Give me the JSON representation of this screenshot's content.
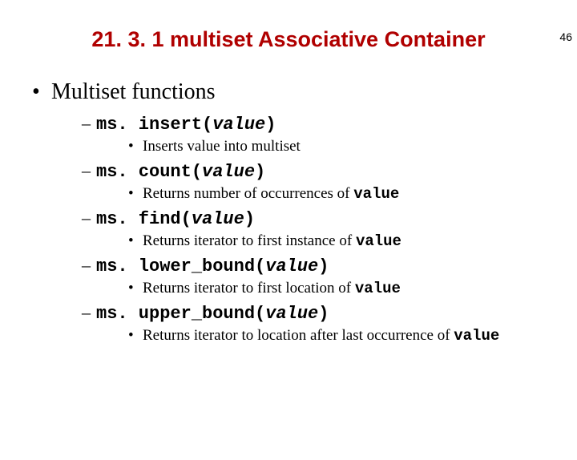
{
  "page_number": "46",
  "title": "21. 3. 1 multiset Associative Container",
  "bullet_l1": "•",
  "dash": "–",
  "bullet_l3": "•",
  "h1": "Multiset functions",
  "items": [
    {
      "code_pre": "ms. insert(",
      "code_arg": "value",
      "code_post": ")",
      "desc_pre": "Inserts value into multiset",
      "desc_code": ""
    },
    {
      "code_pre": "ms. count(",
      "code_arg": "value",
      "code_post": ")",
      "desc_pre": "Returns number of occurrences of ",
      "desc_code": "value"
    },
    {
      "code_pre": "ms. find(",
      "code_arg": "value",
      "code_post": ")",
      "desc_pre": "Returns iterator to first instance of ",
      "desc_code": "value"
    },
    {
      "code_pre": "ms. lower_bound(",
      "code_arg": "value",
      "code_post": ")",
      "desc_pre": "Returns iterator to first location of  ",
      "desc_code": "value"
    },
    {
      "code_pre": "ms. upper_bound(",
      "code_arg": "value",
      "code_post": ")",
      "desc_pre": "Returns iterator to location after last occurrence of ",
      "desc_code": "value"
    }
  ]
}
